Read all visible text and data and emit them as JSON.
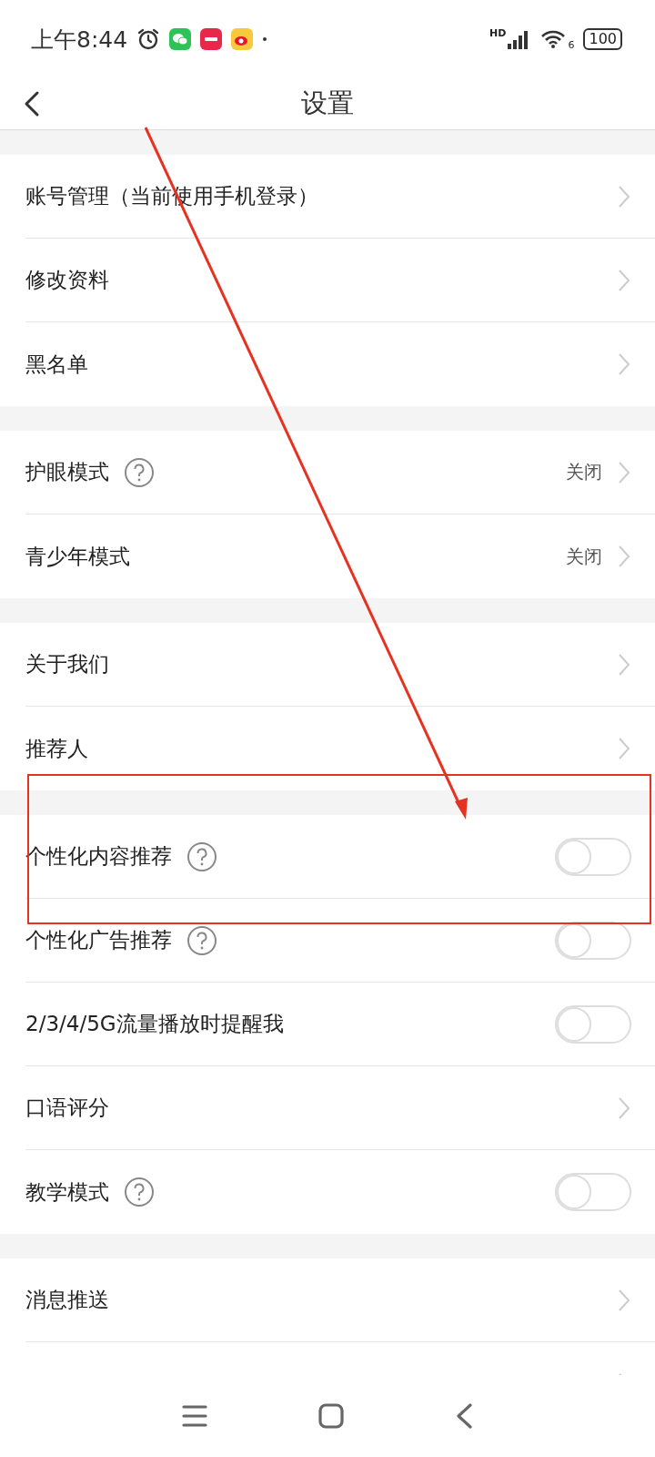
{
  "status_bar": {
    "time": "上午8:44",
    "network": "HD",
    "wifi_band": "6",
    "battery": "100"
  },
  "header": {
    "title": "设置"
  },
  "sections": [
    {
      "rows": [
        {
          "kind": "link",
          "label": "账号管理（当前使用手机登录）",
          "help": false
        },
        {
          "kind": "link",
          "label": "修改资料",
          "help": false
        },
        {
          "kind": "link",
          "label": "黑名单",
          "help": false
        }
      ]
    },
    {
      "rows": [
        {
          "kind": "link",
          "label": "护眼模式",
          "help": true,
          "value": "关闭"
        },
        {
          "kind": "link",
          "label": "青少年模式",
          "help": false,
          "value": "关闭"
        }
      ]
    },
    {
      "rows": [
        {
          "kind": "link",
          "label": "关于我们",
          "help": false
        },
        {
          "kind": "link",
          "label": "推荐人",
          "help": false
        }
      ]
    },
    {
      "rows": [
        {
          "kind": "toggle",
          "label": "个性化内容推荐",
          "help": true,
          "on": false
        },
        {
          "kind": "toggle",
          "label": "个性化广告推荐",
          "help": true,
          "on": false
        },
        {
          "kind": "toggle",
          "label": "2/3/4/5G流量播放时提醒我",
          "help": false,
          "on": false
        },
        {
          "kind": "link",
          "label": "口语评分",
          "help": false
        },
        {
          "kind": "toggle",
          "label": "教学模式",
          "help": true,
          "on": false
        }
      ]
    },
    {
      "rows": [
        {
          "kind": "link",
          "label": "消息推送",
          "help": false
        },
        {
          "kind": "link",
          "help": false
        }
      ]
    }
  ]
}
